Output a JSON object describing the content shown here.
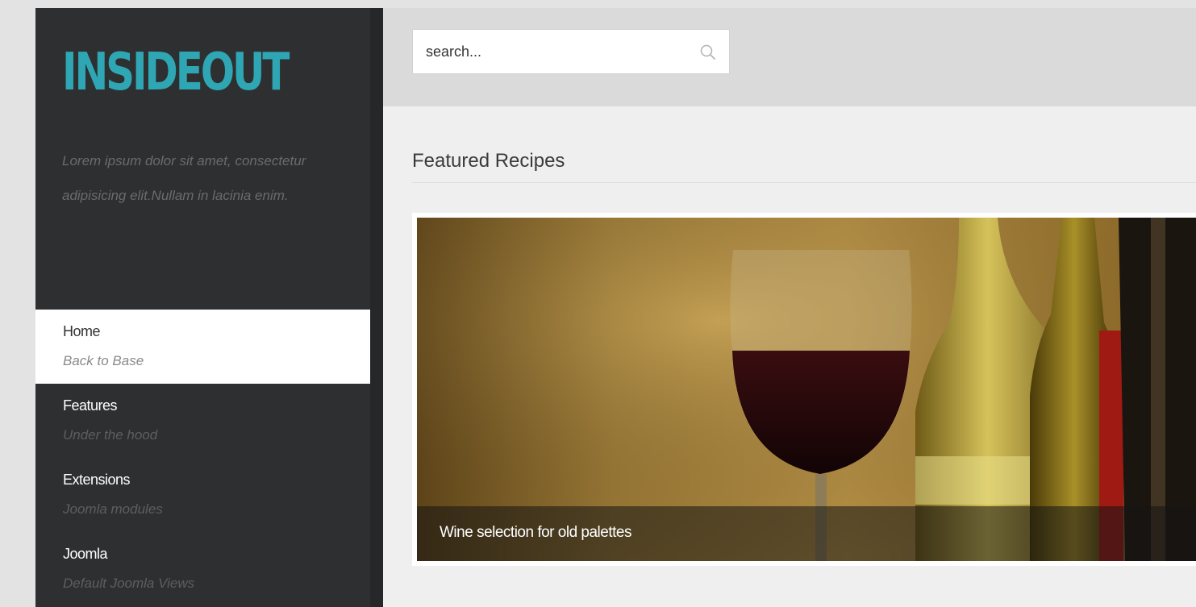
{
  "sidebar": {
    "logo": "INSIDEOUT",
    "tagline": "Lorem ipsum dolor sit amet, consectetur adipisicing elit.Nullam in lacinia enim.",
    "items": [
      {
        "title": "Home",
        "subtitle": "Back to Base"
      },
      {
        "title": "Features",
        "subtitle": "Under the hood"
      },
      {
        "title": "Extensions",
        "subtitle": "Joomla modules"
      },
      {
        "title": "Joomla",
        "subtitle": "Default Joomla Views"
      }
    ]
  },
  "header": {
    "search": {
      "placeholder": "search...",
      "icon": "search-icon"
    }
  },
  "main": {
    "section_title": "Featured Recipes",
    "feature": {
      "caption": "Wine selection for old palettes"
    }
  },
  "colors": {
    "brand": "#2ea6b3",
    "sidebar_bg": "#2e2f30",
    "active_item_bg": "#ffffff"
  }
}
